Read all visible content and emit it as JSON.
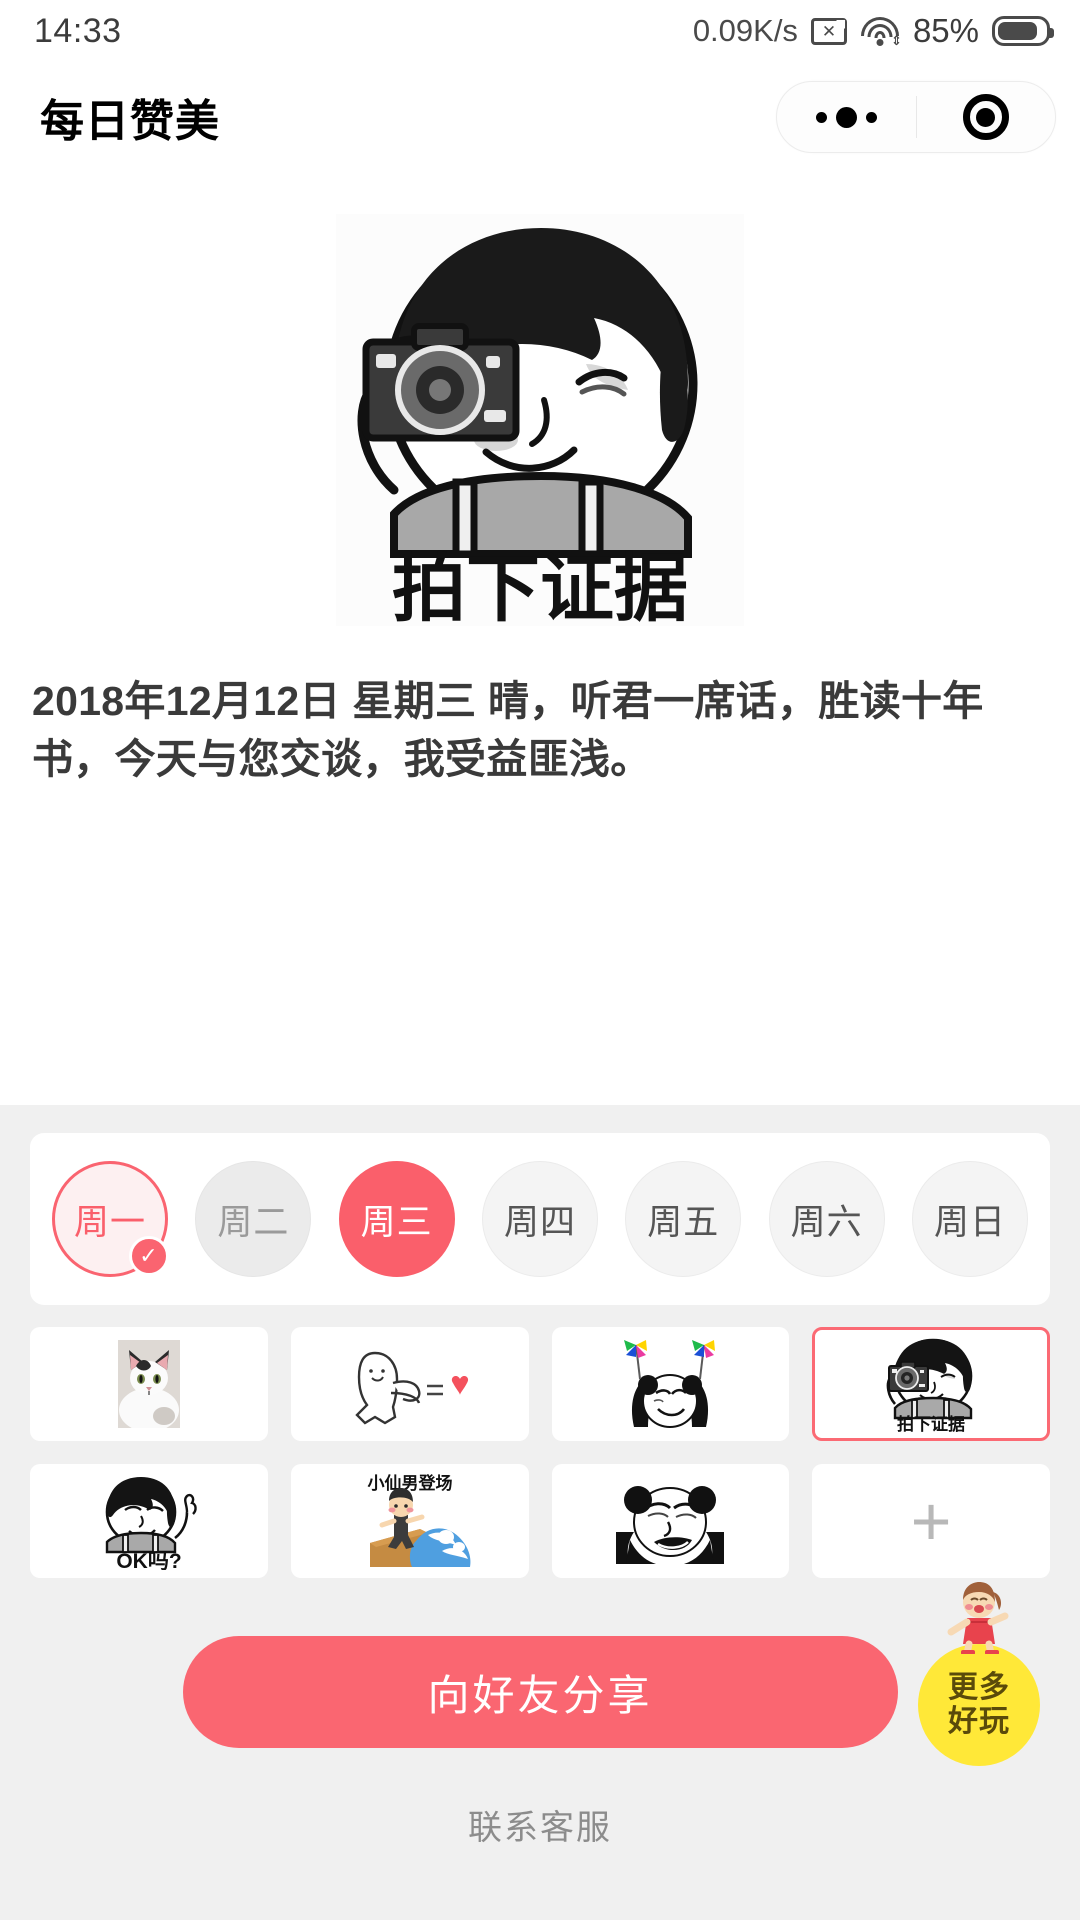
{
  "status_bar": {
    "time": "14:33",
    "network_speed": "0.09K/s",
    "sim_icon": "sim-disabled-icon",
    "wifi_icon": "wifi-icon",
    "battery_percent": "85%",
    "battery_icon": "battery-icon"
  },
  "nav": {
    "title": "每日赞美",
    "more_icon": "more-dots-icon",
    "close_icon": "target-circle-icon"
  },
  "hero": {
    "caption": "拍下证据",
    "alt_name": "camera-meme-image"
  },
  "quote": {
    "text": "2018年12月12日 星期三 晴，听君一席话，胜读十年书，今天与您交谈，我受益匪浅。"
  },
  "weekdays": [
    {
      "label": "周一",
      "state": "selected",
      "has_check": true
    },
    {
      "label": "周二",
      "state": "muted",
      "has_check": false
    },
    {
      "label": "周三",
      "state": "today",
      "has_check": false
    },
    {
      "label": "周四",
      "state": "plain",
      "has_check": false
    },
    {
      "label": "周五",
      "state": "plain",
      "has_check": false
    },
    {
      "label": "周六",
      "state": "plain",
      "has_check": false
    },
    {
      "label": "周日",
      "state": "plain",
      "has_check": false
    }
  ],
  "stickers": [
    {
      "name": "cat-photo-sticker",
      "caption": "",
      "selected": false,
      "kind": "cat"
    },
    {
      "name": "punch-heart-sticker",
      "caption": "",
      "selected": false,
      "kind": "punch"
    },
    {
      "name": "panda-pinwheel-sticker",
      "caption": "",
      "selected": false,
      "kind": "pinwheel"
    },
    {
      "name": "camera-evidence-sticker",
      "caption": "拍下证据",
      "selected": true,
      "kind": "camera"
    },
    {
      "name": "ok-ma-sticker",
      "caption": "OK吗?",
      "selected": false,
      "kind": "ok"
    },
    {
      "name": "little-fairy-sticker",
      "caption": "小仙男登场",
      "selected": false,
      "kind": "surf"
    },
    {
      "name": "panda-face-sticker",
      "caption": "",
      "selected": false,
      "kind": "panda"
    },
    {
      "name": "add-sticker",
      "caption": "+",
      "selected": false,
      "kind": "plus"
    }
  ],
  "actions": {
    "share_label": "向好友分享",
    "more_fun_line1": "更多",
    "more_fun_line2": "好玩",
    "service_label": "联系客服"
  },
  "colors": {
    "accent_red": "#fa6671",
    "accent_red_soft": "#fdf0f1",
    "today_red": "#fa5f6b",
    "panel_bg": "#f0f0f0",
    "badge_yellow": "#ffe838",
    "muted_text": "#8c8c8c"
  }
}
